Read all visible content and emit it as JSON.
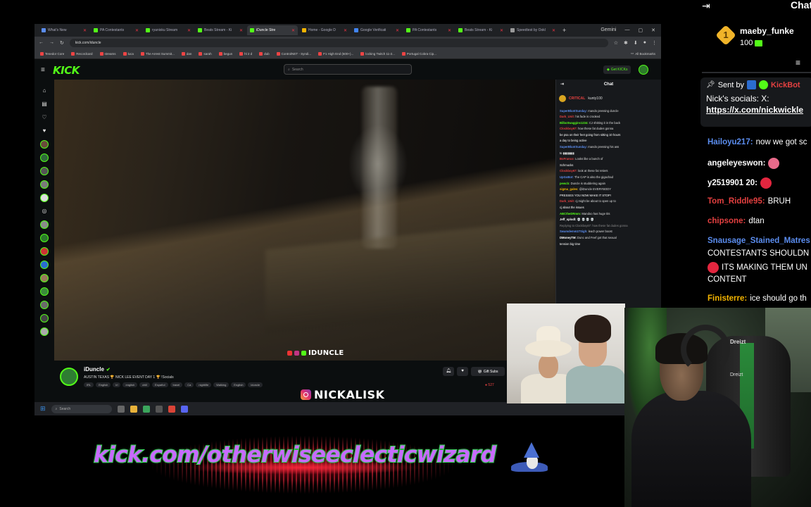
{
  "browser": {
    "tabs": [
      {
        "label": "What's New",
        "color": "#5b8def",
        "active": false
      },
      {
        "label": "PA Contestants",
        "color": "#53fc18",
        "active": false
      },
      {
        "label": "ryanisku Stream",
        "color": "#53fc18",
        "active": false
      },
      {
        "label": "Beats Stream - Ki",
        "color": "#53fc18",
        "active": false
      },
      {
        "label": "iDuncle Stre",
        "color": "#53fc18",
        "active": true
      },
      {
        "label": "Home - Google D",
        "color": "#f4b400",
        "active": false
      },
      {
        "label": "Google Verificati",
        "color": "#4285f4",
        "active": false
      },
      {
        "label": "PA Contestants",
        "color": "#53fc18",
        "active": false
      },
      {
        "label": "Beats Stream - Ki",
        "color": "#53fc18",
        "active": false
      },
      {
        "label": "Speedtest by Ookl",
        "color": "#999999",
        "active": false
      },
      {
        "label": "Gemini",
        "color": "#8ab4f8",
        "active": false
      }
    ],
    "url": "kick.com/iduncle",
    "bookmarks": [
      "Tenedor Core",
      "Recordcard",
      "streams",
      "luca",
      "The Arrest Summit...",
      "dan",
      "sarah",
      "begun",
      "hl 2 d",
      "dub",
      "ControlNET - Syndi...",
      "F1 High End (600+)...",
      "locking Twitch 11-2...",
      "Portugal Cobra Cip..."
    ],
    "bookmarks_all": "All Bookmarks"
  },
  "kick": {
    "logo": "KICK",
    "search_placeholder": "Search",
    "get_kicks": "Get KICKs",
    "streamer": "iDuncle",
    "title": "AUSTIN TEXAS 🏆 NICK LEE EVENT DAY 1 🏆 !Socials",
    "tags": [
      "IRL",
      "English",
      "irl",
      "english",
      "chill",
      "Español",
      "travel",
      "Ca",
      "nightlife",
      "Walking",
      "English",
      "iduncle"
    ],
    "gift_subs": "Gift Subs",
    "viewers": "527",
    "video_watermark": "IDUNCLE"
  },
  "inner_chat": {
    "title": "Chat",
    "pinned_left": "CRITICAL",
    "pinned_right": "kunty100",
    "messages": [
      {
        "user": "SuperBluntSunday:",
        "text": "mando pressing duncle",
        "color": "#5b8def"
      },
      {
        "user": "Dark_Unit:",
        "text": "his fade is crooked",
        "color": "#e34040"
      },
      {
        "user": "BilboSwaggins1234:",
        "text": "CJ shitting it in the back",
        "color": "#53fc18"
      },
      {
        "user": "Clockboy67:",
        "text": "how these fat dudes gonna",
        "color": "#e34040"
      },
      {
        "user": "",
        "text": "be psa on their feet going from sitting 10 hours",
        "color": "#ffffff"
      },
      {
        "user": "",
        "text": "a day to being active",
        "color": "#ffffff"
      },
      {
        "user": "SuperBluntSunday:",
        "text": "mando pressing his ass",
        "color": "#5b8def"
      },
      {
        "user": "",
        "text": "to ▮▮▮▮▮▮▮",
        "color": "#ffffff"
      },
      {
        "user": "BoFranco:",
        "text": "Looks like a bunch of",
        "color": "#e34040"
      },
      {
        "user": "",
        "text": "Schmucks",
        "color": "#ffffff"
      },
      {
        "user": "Clockboy67:",
        "text": "look at these fat retiers",
        "color": "#e34040"
      },
      {
        "user": "UpGoBot:",
        "text": "The CAP is also the gigachad",
        "color": "#5b8def"
      },
      {
        "user": "pewcb:",
        "text": "Duncle is studdering again",
        "color": "#53fc18"
      },
      {
        "user": "sigma_gales:",
        "text": "@iDuncle EVERYBODY",
        "color": "#f4b400"
      },
      {
        "user": "",
        "text": "PRESSES YOU NOW MAKE IT STOP!",
        "color": "#ffffff"
      },
      {
        "user": "Dark_Unit:",
        "text": "cj might be about to open up to",
        "color": "#e34040"
      },
      {
        "user": "",
        "text": "cj about the issues",
        "color": "#ffffff"
      },
      {
        "user": "ABCtheDRmm:",
        "text": "Mandoo has huge tits",
        "color": "#53fc18"
      },
      {
        "user": "Jeff_splodl:",
        "text": "💀 💀 💀 💀",
        "color": "#ffffff"
      },
      {
        "user": "",
        "text": "Replying to Clockboy67: how these fat dudes gonna",
        "color": "#888888"
      },
      {
        "user": "Swamdemm27Sigh:",
        "text": "leach power boost",
        "color": "#5b8def"
      },
      {
        "user": "DMoneyTM:",
        "text": "Dunc and Feef got that sexual",
        "color": "#ffffff"
      },
      {
        "user": "",
        "text": "tension big time",
        "color": "#ffffff"
      }
    ]
  },
  "taskbar": {
    "search_placeholder": "Search"
  },
  "ig_handle": "NICKALISK",
  "right_chat": {
    "title": "Chat",
    "leader": {
      "rank": "1",
      "name": "maeby_funke",
      "amount": "100"
    },
    "pinned": {
      "sent_by_label": "Sent by",
      "sent_by_user": "KickBot",
      "text": "Nick's socials: X:",
      "link": "https://x.com/nickwickle"
    },
    "messages": [
      {
        "user": "Hailoyu217:",
        "text": "now we got sc",
        "color": "#5b8def"
      },
      {
        "user": "angeleyeswon:",
        "text": "",
        "color": "#ffffff",
        "emote": "#e86a8a"
      },
      {
        "user": "y2519901 20:",
        "text": "",
        "color": "#ffffff",
        "emote": "#e3263f"
      },
      {
        "user": "Tom_Riddle95:",
        "text": "BRUH",
        "color": "#e34040"
      },
      {
        "user": "chipsone:",
        "text": "dtan",
        "color": "#e34040"
      },
      {
        "user": "Snausage_Stained_Matres",
        "text": "",
        "color": "#5b8def"
      },
      {
        "user": "",
        "text": "CONTESTANTS SHOULDN",
        "color": "#ffffff"
      },
      {
        "user": "",
        "text": "ITS MAKING THEM UN",
        "color": "#ffffff",
        "emote": "#e3263f"
      },
      {
        "user": "",
        "text": "CONTENT",
        "color": "#ffffff"
      },
      {
        "user": "Finisterre:",
        "text": "ice should go th",
        "color": "#f4b400"
      }
    ]
  },
  "webcam": {
    "chair_brand": "Dreizt"
  },
  "banner": {
    "text": "kick.com/otherwiseeclecticwizard"
  }
}
